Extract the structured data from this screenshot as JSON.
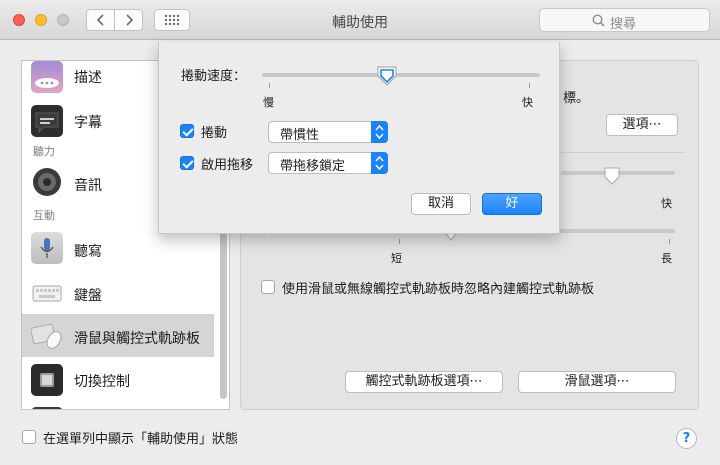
{
  "window": {
    "title": "輔助使用"
  },
  "search": {
    "placeholder": "搜尋"
  },
  "sidebar": {
    "items": [
      {
        "label": "描述",
        "icon": "speech-bubble-icon"
      },
      {
        "label": "字幕",
        "icon": "captions-icon"
      },
      {
        "label": "音訊",
        "icon": "speaker-icon"
      },
      {
        "label": "聽寫",
        "icon": "microphone-icon"
      },
      {
        "label": "鍵盤",
        "icon": "keyboard-icon"
      },
      {
        "label": "滑鼠與觸控式軌跡板",
        "icon": "mouse-trackpad-icon",
        "selected": true
      },
      {
        "label": "切換控制",
        "icon": "switch-control-icon"
      }
    ],
    "headers": {
      "hearing": "聽力",
      "interaction": "互動"
    }
  },
  "panel": {
    "partial_text": "標。",
    "options_button": "選項⋯",
    "slider1_fast": "快",
    "slider2_short": "短",
    "slider2_long": "長",
    "ignore_trackpad_label": "使用滑鼠或無線觸控式軌跡板時忽略內建觸控式軌跡板",
    "trackpad_options_button": "觸控式軌跡板選項⋯",
    "mouse_options_button": "滑鼠選項⋯"
  },
  "footer": {
    "show_in_menubar_label": "在選單列中顯示「輔助使用」狀態",
    "help": "?"
  },
  "sheet": {
    "scroll_speed_label": "捲動速度：",
    "scroll_speed_min": "慢",
    "scroll_speed_max": "快",
    "scroll_speed_value": 0.45,
    "scroll_checkbox_label": "捲動",
    "scroll_checkbox_checked": true,
    "scroll_popup_value": "帶慣性",
    "drag_checkbox_label": "啟用拖移",
    "drag_checkbox_checked": true,
    "drag_popup_value": "帶拖移鎖定",
    "cancel_button": "取消",
    "ok_button": "好"
  },
  "colors": {
    "accent": "#1a82fb",
    "close": "#fe5f57",
    "minimize": "#febc2e"
  }
}
